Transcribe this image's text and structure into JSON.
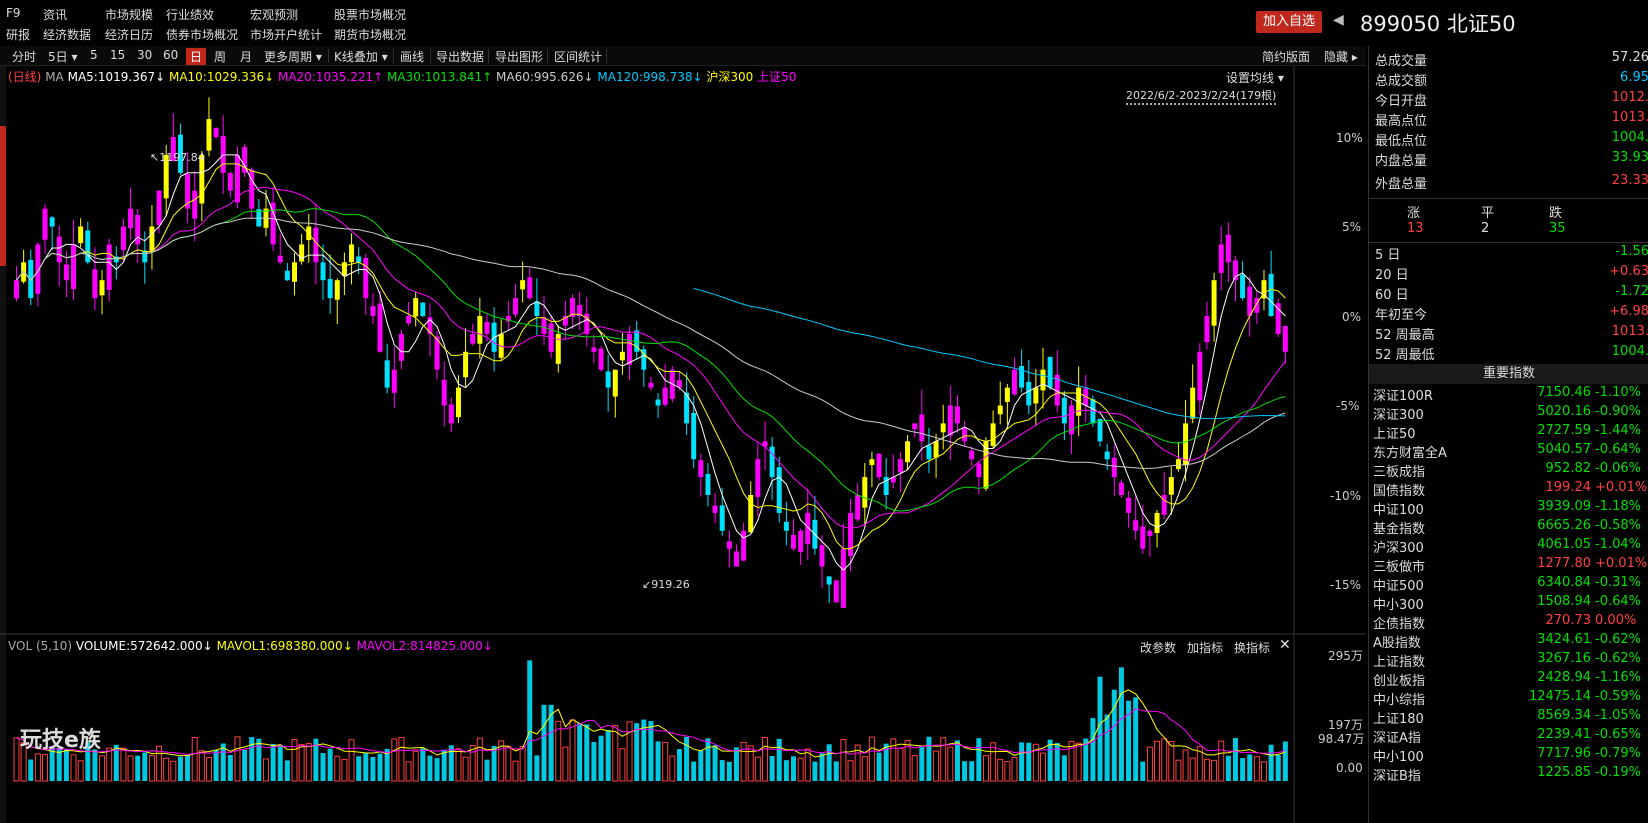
{
  "topbar": {
    "f9": "F9",
    "row1": [
      "资讯",
      "市场规模",
      "行业绩效",
      "宏观预测",
      "股票市场概况"
    ],
    "row2": [
      "研报",
      "经济数据",
      "经济日历",
      "债券市场概况",
      "市场开户统计",
      "期货市场概况"
    ],
    "add_fav": "加入自选",
    "code": "899050",
    "name": "北证50"
  },
  "toolbar": {
    "periods": [
      "分时",
      "5日",
      "5",
      "15",
      "30",
      "60",
      "日",
      "周",
      "月",
      "更多周期"
    ],
    "tools": [
      "K线叠加",
      "画线",
      "导出数据",
      "导出图形",
      "区间统计"
    ],
    "right": [
      "简约版面",
      "隐藏"
    ]
  },
  "ma_legend": {
    "prefix": "(日线)",
    "ma": "MA",
    "items": [
      {
        "text": "MA5:1019.367↓",
        "color": "#ffffff"
      },
      {
        "text": "MA10:1029.336↓",
        "color": "#ffff00"
      },
      {
        "text": "MA20:1035.221↑",
        "color": "#ff00ff"
      },
      {
        "text": "MA30:1013.841↑",
        "color": "#00e000"
      },
      {
        "text": "MA60:995.626↓",
        "color": "#cccccc"
      },
      {
        "text": "MA120:998.738↓",
        "color": "#00c8ff"
      },
      {
        "text": "沪深300",
        "color": "#ffff00"
      },
      {
        "text": "上证50",
        "color": "#ff00ff"
      }
    ],
    "settings": "设置均线",
    "range": "2022/6/2-2023/2/24(179根)"
  },
  "price_axis": [
    "10%",
    "5%",
    "0%",
    "-5%",
    "-10%",
    "-15%"
  ],
  "annotations": {
    "high": "1197.84",
    "low": "919.26"
  },
  "vol_legend": {
    "prefix": "VOL (5,10)",
    "volume": "VOLUME:572642.000↓",
    "mavol1": "MAVOL1:698380.000↓",
    "mavol2": "MAVOL2:814825.000↓",
    "buttons": [
      "改参数",
      "加指标",
      "换指标"
    ]
  },
  "vol_axis": [
    "295万",
    "197万",
    "98.47万",
    "0.00"
  ],
  "watermark": "玩技e族",
  "rpanel": {
    "stats": [
      {
        "label": "总成交量",
        "value": "57.26",
        "color": "#dddddd"
      },
      {
        "label": "总成交额",
        "value": "6.95",
        "color": "#00c8ff"
      },
      {
        "label": "今日开盘",
        "value": "1012.",
        "color": "#ff4040"
      },
      {
        "label": "最高点位",
        "value": "1013.",
        "color": "#ff4040"
      },
      {
        "label": "最低点位",
        "value": "1004.",
        "color": "#00e000"
      },
      {
        "label": "内盘总量",
        "value": "33.93",
        "color": "#00e000"
      },
      {
        "label": "外盘总量",
        "value": "23.33",
        "color": "#ff4040"
      }
    ],
    "breadth": {
      "headers": [
        "涨",
        "平",
        "跌"
      ],
      "values": [
        "13",
        "2",
        "35"
      ]
    },
    "periods": [
      {
        "label": "5 日",
        "value": "-1.56",
        "color": "#00e000"
      },
      {
        "label": "20 日",
        "value": "+0.63",
        "color": "#ff4040"
      },
      {
        "label": "60 日",
        "value": "-1.72",
        "color": "#00e000"
      },
      {
        "label": "年初至今",
        "value": "+6.98",
        "color": "#ff4040"
      },
      {
        "label": "52 周最高",
        "value": "1013.",
        "color": "#ff4040"
      },
      {
        "label": "52 周最低",
        "value": "1004.",
        "color": "#00e000"
      }
    ],
    "index_header": "重要指数",
    "indices": [
      {
        "name": "深证100R",
        "price": "7150.46",
        "chg": "-1.10%",
        "color": "#00e000"
      },
      {
        "name": "深证300",
        "price": "5020.16",
        "chg": "-0.90%",
        "color": "#00e000"
      },
      {
        "name": "上证50",
        "price": "2727.59",
        "chg": "-1.44%",
        "color": "#00e000"
      },
      {
        "name": "东方财富全A",
        "price": "5040.57",
        "chg": "-0.64%",
        "color": "#00e000"
      },
      {
        "name": "三板成指",
        "price": "952.82",
        "chg": "-0.06%",
        "color": "#00e000"
      },
      {
        "name": "国债指数",
        "price": "199.24",
        "chg": "+0.01%",
        "color": "#ff4040"
      },
      {
        "name": "中证100",
        "price": "3939.09",
        "chg": "-1.18%",
        "color": "#00e000"
      },
      {
        "name": "基金指数",
        "price": "6665.26",
        "chg": "-0.58%",
        "color": "#00e000"
      },
      {
        "name": "沪深300",
        "price": "4061.05",
        "chg": "-1.04%",
        "color": "#00e000"
      },
      {
        "name": "三板做市",
        "price": "1277.80",
        "chg": "+0.01%",
        "color": "#ff4040"
      },
      {
        "name": "中证500",
        "price": "6340.84",
        "chg": "-0.31%",
        "color": "#00e000"
      },
      {
        "name": "中小300",
        "price": "1508.94",
        "chg": "-0.64%",
        "color": "#00e000"
      },
      {
        "name": "企债指数",
        "price": "270.73",
        "chg": "0.00%",
        "color": "#ff4040"
      },
      {
        "name": "A股指数",
        "price": "3424.61",
        "chg": "-0.62%",
        "color": "#00e000"
      },
      {
        "name": "上证指数",
        "price": "3267.16",
        "chg": "-0.62%",
        "color": "#00e000"
      },
      {
        "name": "创业板指",
        "price": "2428.94",
        "chg": "-1.16%",
        "color": "#00e000"
      },
      {
        "name": "中小综指",
        "price": "12475.14",
        "chg": "-0.59%",
        "color": "#00e000"
      },
      {
        "name": "上证180",
        "price": "8569.34",
        "chg": "-1.05%",
        "color": "#00e000"
      },
      {
        "name": "深证A指",
        "price": "2239.41",
        "chg": "-0.65%",
        "color": "#00e000"
      },
      {
        "name": "中小100",
        "price": "7717.96",
        "chg": "-0.79%",
        "color": "#00e000"
      },
      {
        "name": "深证B指",
        "price": "1225.85",
        "chg": "-0.19%",
        "color": "#00e000"
      }
    ]
  },
  "chart_data": {
    "type": "candlestick",
    "period": "2022/6/2-2023/2/24",
    "bars": 179,
    "range_pct": [
      -17,
      12
    ],
    "annotations": [
      {
        "label": "1197.84",
        "kind": "high"
      },
      {
        "label": "919.26",
        "kind": "low"
      }
    ],
    "close_pct": [
      2,
      3,
      1,
      4,
      6,
      5,
      3,
      2,
      4,
      5,
      3,
      1,
      2,
      4,
      3,
      5,
      6,
      4,
      3,
      5,
      7,
      9,
      10,
      8,
      6,
      7,
      9,
      11,
      10,
      8,
      7,
      9,
      8,
      6,
      5,
      6,
      4,
      3,
      2,
      3,
      4,
      5,
      3,
      2,
      1,
      2,
      3,
      4,
      3,
      1,
      0,
      -2,
      -4,
      -3,
      -1,
      0,
      1,
      0,
      -1,
      -3,
      -5,
      -6,
      -4,
      -2,
      -1,
      0,
      -1,
      -2,
      -1,
      0,
      1,
      2,
      1,
      0,
      -1,
      -2,
      -1,
      0,
      1,
      0,
      -1,
      -2,
      -3,
      -4,
      -3,
      -2,
      -1,
      -2,
      -3,
      -4,
      -5,
      -4,
      -3,
      -4,
      -6,
      -8,
      -9,
      -10,
      -11,
      -12,
      -13,
      -14,
      -12,
      -10,
      -8,
      -7,
      -9,
      -11,
      -12,
      -13,
      -12,
      -11,
      -13,
      -14,
      -15,
      -16,
      -13,
      -11,
      -10,
      -9,
      -8,
      -9,
      -10,
      -9,
      -8,
      -7,
      -6,
      -7,
      -8,
      -7,
      -6,
      -5,
      -6,
      -7,
      -8,
      -9,
      -7,
      -6,
      -5,
      -4,
      -3,
      -4,
      -5,
      -4,
      -3,
      -4,
      -5,
      -6,
      -5,
      -4,
      -5,
      -6,
      -7,
      -8,
      -9,
      -10,
      -11,
      -12,
      -13,
      -12,
      -11,
      -10,
      -9,
      -8,
      -6,
      -4,
      -2,
      0,
      2,
      4,
      3,
      2,
      1,
      0,
      1,
      2,
      0,
      -1,
      -2
    ],
    "ma": [
      {
        "name": "MA5",
        "color": "#ffffff"
      },
      {
        "name": "MA10",
        "color": "#ffff00"
      },
      {
        "name": "MA20",
        "color": "#ff00ff"
      },
      {
        "name": "MA30",
        "color": "#00e000"
      },
      {
        "name": "MA60",
        "color": "#cccccc"
      },
      {
        "name": "MA120",
        "color": "#00c8ff"
      }
    ],
    "volume_ylim": [
      0,
      2950000
    ]
  }
}
